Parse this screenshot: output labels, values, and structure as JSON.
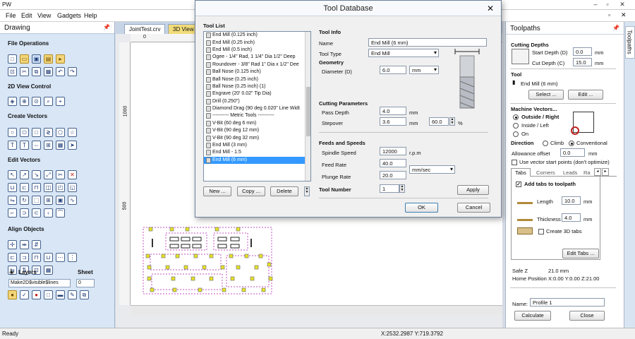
{
  "app": {
    "title": "PW"
  },
  "menu": [
    "File",
    "Edit",
    "View",
    "Gadgets",
    "Help"
  ],
  "left_panel": {
    "title": "Drawing",
    "sections": {
      "file_operations": "File Operations",
      "view_control": "2D View Control",
      "create_vectors": "Create Vectors",
      "edit_vectors": "Edit Vectors",
      "align_objects": "Align Objects",
      "layers": "Layers",
      "sheet": "Sheet"
    },
    "layer_value": "Make2D$visible$lines",
    "sheet_value": "0"
  },
  "doc_tabs": [
    "JointTest.crv",
    "3D View"
  ],
  "ruler": {
    "top_0": "0",
    "left_1000": "1000",
    "left_500": "500"
  },
  "dialog": {
    "title": "Tool Database",
    "tool_list_label": "Tool List",
    "tool_list": [
      "End Mill (0.125 inch)",
      "End Mill (0.25 inch)",
      "End Mill (0.5 inch)",
      "Ogee - 1/4\" Rad, 1 1/4\" Dia 1/2\" Deep",
      "Roundover - 3/8\" Rad 1\" Dia x 1/2\" Dee",
      "Ball Nose (0.125 inch)",
      "Ball Nose (0.25 inch)",
      "Ball Nose (0.25 inch) (1)",
      "Engrave (20' 0.02\" Tip Dia)",
      "Drill (0.250\")",
      "Diamond Drag (90 deg 0.020\" Line Widt",
      "---------- Metric Tools ----------",
      "V-Bit (60 deg 6 mm)",
      "V-Bit (90 deg 12 mm)",
      "V-Bit (90 deg 32 mm)",
      "End Mill (3 mm)",
      "End Mill - 1.5",
      "End Mill (6 mm)"
    ],
    "selected_index": 17,
    "buttons": {
      "new": "New ...",
      "copy": "Copy ...",
      "delete": "Delete",
      "apply": "Apply",
      "ok": "OK",
      "cancel": "Cancel"
    },
    "tool_info": {
      "heading": "Tool Info",
      "name_label": "Name",
      "name_value": "End Mill (6 mm)",
      "type_label": "Tool Type",
      "type_value": "End Mill"
    },
    "geometry": {
      "heading": "Geometry",
      "diameter_label": "Diameter (D)",
      "diameter_value": "6.0",
      "units_value": "mm"
    },
    "cutting": {
      "heading": "Cutting Parameters",
      "pass_depth_label": "Pass Depth",
      "pass_depth_value": "4.0",
      "pass_depth_unit": "mm",
      "stepover_label": "Stepover",
      "stepover_value": "3.6",
      "stepover_unit": "mm",
      "stepover_pct": "60.0",
      "pct_sign": "%"
    },
    "feeds": {
      "heading": "Feeds and Speeds",
      "spindle_label": "Spindle Speed",
      "spindle_value": "12000",
      "spindle_unit": "r.p.m",
      "feed_label": "Feed Rate",
      "feed_value": "40.0",
      "plunge_label": "Plunge Rate",
      "plunge_value": "20.0",
      "rate_unit": "mm/sec"
    },
    "tool_number": {
      "label": "Tool Number",
      "value": "1"
    }
  },
  "right_panel": {
    "title": "Toolpaths",
    "side_tab": "Toolpaths",
    "cutting_depths": "Cutting Depths",
    "start_depth_label": "Start Depth (D)",
    "start_depth_value": "0.0",
    "cut_depth_label": "Cut Depth (C)",
    "cut_depth_value": "15.0",
    "unit": "mm",
    "tool_heading": "Tool",
    "tool_name": "End Mill (6 mm)",
    "select_btn": "Select ...",
    "edit_btn": "Edit ...",
    "machine_vectors": "Machine Vectors...",
    "outside": "Outside / Right",
    "inside": "Inside / Left",
    "on": "On",
    "direction": "Direction",
    "climb": "Climb",
    "conventional": "Conventional",
    "allowance_label": "Allowance offset",
    "allowance_value": "0.0",
    "vector_start": "Use vector start points (don't optimize)",
    "tabs": [
      "Tabs",
      "Corners",
      "Leads",
      "Ra"
    ],
    "add_tabs": "Add tabs to toolpath",
    "length_label": "Length",
    "length_value": "10.0",
    "thickness_label": "Thickness",
    "thickness_value": "4.0",
    "create_3d": "Create 3D tabs",
    "edit_tabs": "Edit Tabs ...",
    "safe_z_label": "Safe Z",
    "safe_z_value": "21.0 mm",
    "home_label": "Home Position",
    "home_value": "X:0.00 Y:0.00 Z:21.00",
    "name_label": "Name:",
    "name_value": "Profile 1",
    "calculate": "Calculate",
    "close": "Close"
  },
  "status": {
    "left": "Ready",
    "coords": "X:2532.2987 Y:719.3792"
  }
}
